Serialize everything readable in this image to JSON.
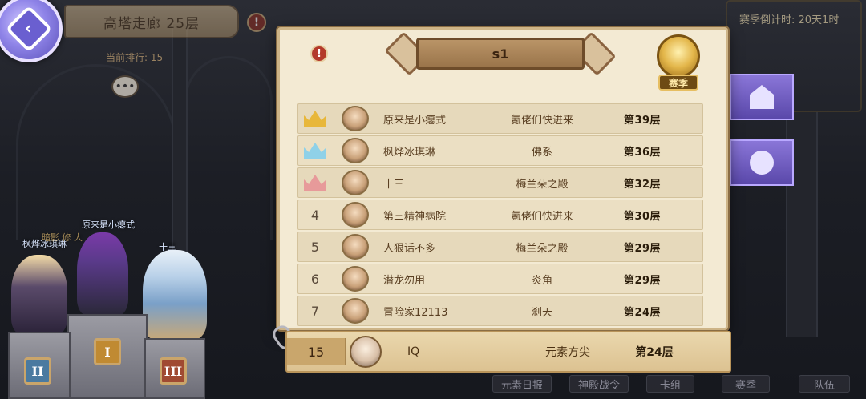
{
  "header": {
    "tower_title": "高塔走廊 25层",
    "current_rank_text": "当前排行: 15",
    "season_countdown": "赛季倒计时: 20天1时"
  },
  "podium": {
    "names": [
      "枫烨冰琪琳",
      "原来是小瘪式",
      "十三"
    ],
    "badges": [
      "II",
      "I",
      "III"
    ],
    "overlay_text": "暗影 修 大"
  },
  "panel": {
    "title": "s1",
    "season_label": "赛季",
    "rows": [
      {
        "rank": "1",
        "name": "原来是小瘪式",
        "guild": "氪佬们快进来",
        "floor": "第39层",
        "crown": "gold"
      },
      {
        "rank": "2",
        "name": "枫烨冰琪琳",
        "guild": "佛系",
        "floor": "第36层",
        "crown": "blue"
      },
      {
        "rank": "3",
        "name": "十三",
        "guild": "梅兰朵之殿",
        "floor": "第32层",
        "crown": "pink"
      },
      {
        "rank": "4",
        "name": "第三精神病院",
        "guild": "氪佬们快进来",
        "floor": "第30层"
      },
      {
        "rank": "5",
        "name": "人狠话不多",
        "guild": "梅兰朵之殿",
        "floor": "第29层"
      },
      {
        "rank": "6",
        "name": "潜龙勿用",
        "guild": "炎角",
        "floor": "第29层"
      },
      {
        "rank": "7",
        "name": "冒险家12113",
        "guild": "刹天",
        "floor": "第24层"
      }
    ],
    "self": {
      "rank": "15",
      "name": "IQ",
      "guild": "元素方尖",
      "floor": "第24层"
    }
  },
  "bottom_bar": {
    "buttons": [
      "元素日报",
      "神殿战令",
      "卡组",
      "赛季",
      "队伍"
    ]
  },
  "colors": {
    "gold": "#e8b73a",
    "blue": "#8fd1e8",
    "pink": "#e79a9a",
    "side_tab": "#7a66cc"
  }
}
